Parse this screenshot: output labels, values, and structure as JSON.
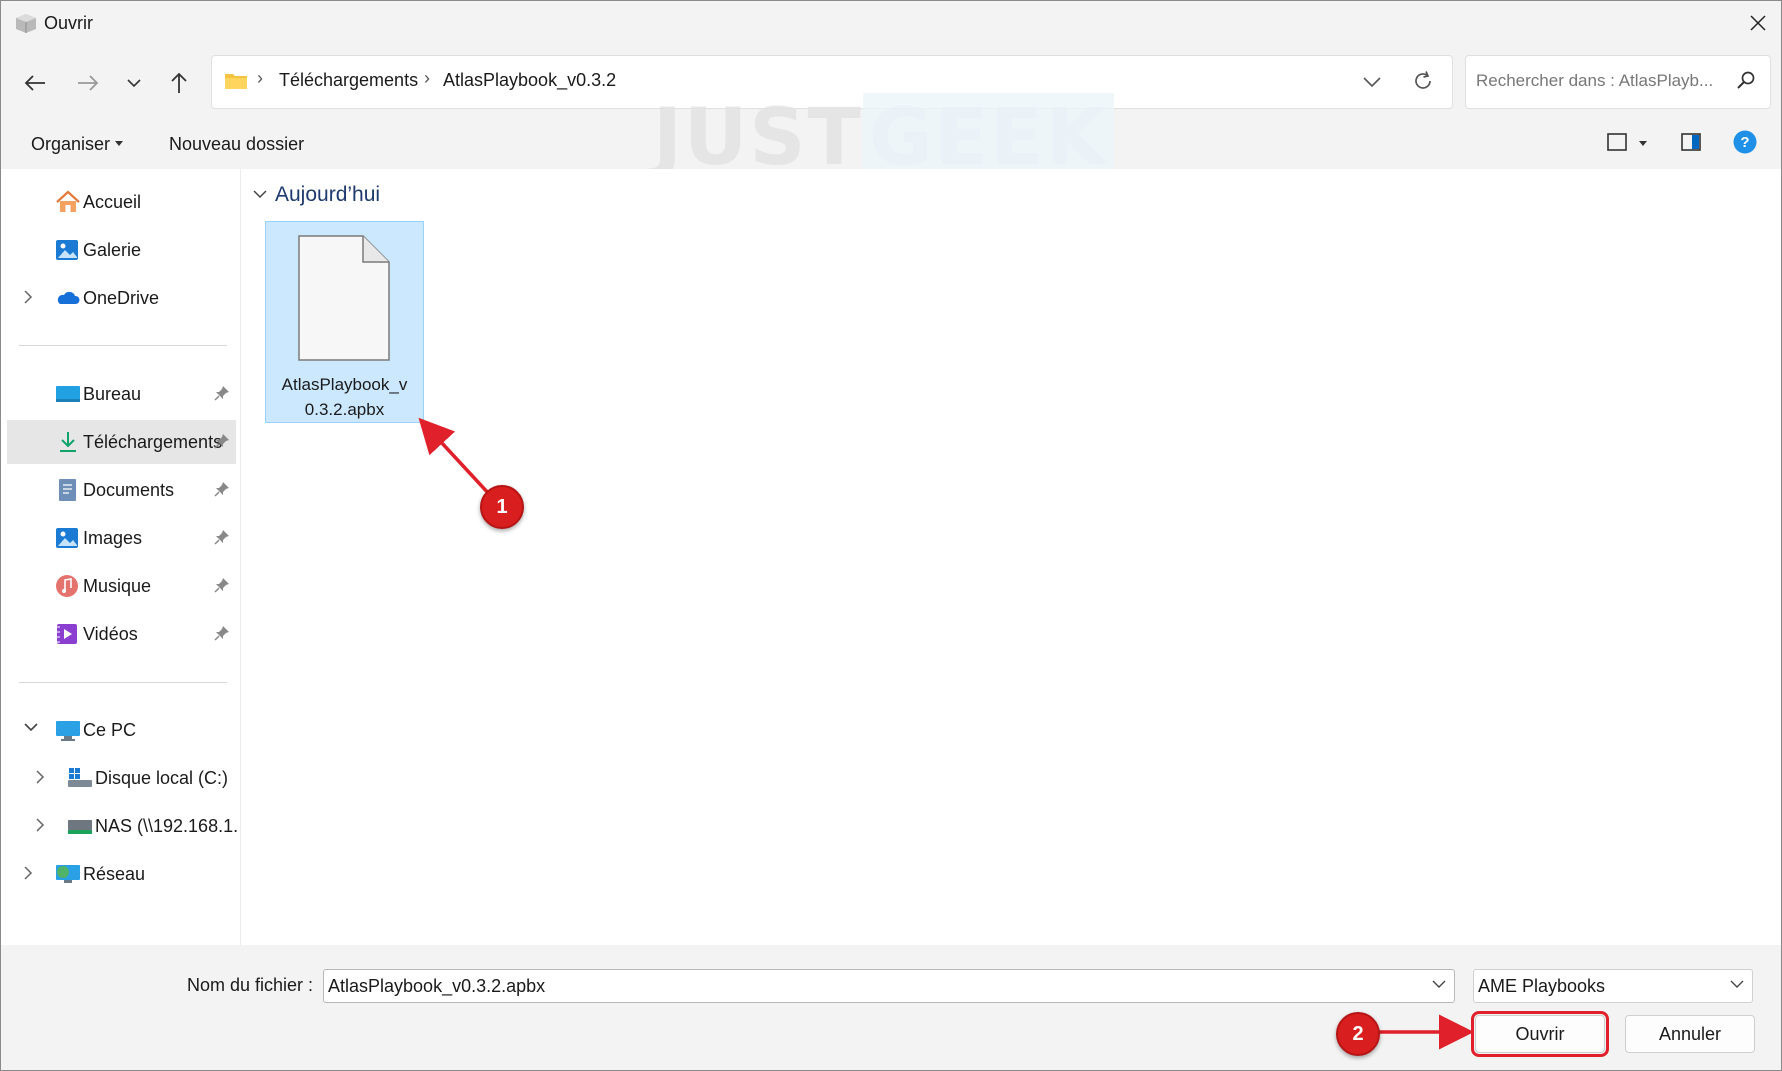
{
  "window": {
    "title": "Ouvrir"
  },
  "address": {
    "crumbs": [
      "Téléchargements",
      "AtlasPlaybook_v0.3.2"
    ],
    "separator": "›"
  },
  "search": {
    "placeholder": "Rechercher dans : AtlasPlayb..."
  },
  "commandbar": {
    "organize": "Organiser",
    "new_folder": "Nouveau dossier"
  },
  "watermark": {
    "part1": "JUST",
    "part2": "GEEK"
  },
  "sidebar": {
    "items": [
      {
        "label": "Accueil",
        "icon": "home-icon"
      },
      {
        "label": "Galerie",
        "icon": "gallery-icon"
      },
      {
        "label": "OneDrive",
        "icon": "onedrive-icon"
      },
      {
        "label": "Bureau",
        "icon": "desktop-icon"
      },
      {
        "label": "Téléchargements",
        "icon": "download-icon"
      },
      {
        "label": "Documents",
        "icon": "documents-icon"
      },
      {
        "label": "Images",
        "icon": "images-icon"
      },
      {
        "label": "Musique",
        "icon": "music-icon"
      },
      {
        "label": "Vidéos",
        "icon": "videos-icon"
      },
      {
        "label": "Ce PC",
        "icon": "pc-icon"
      },
      {
        "label": "Disque local (C:)",
        "icon": "drive-icon"
      },
      {
        "label": "NAS (\\\\192.168.1.",
        "icon": "nas-icon"
      },
      {
        "label": "Réseau",
        "icon": "network-icon"
      }
    ]
  },
  "main": {
    "group_label": "Aujourd’hui",
    "files": [
      {
        "name_line1": "AtlasPlaybook_v",
        "name_line2": "0.3.2.apbx"
      }
    ]
  },
  "footer": {
    "filename_label": "Nom du fichier :",
    "filename_value": "AtlasPlaybook_v0.3.2.apbx",
    "filetype_value": "AME Playbooks",
    "open_label": "Ouvrir",
    "cancel_label": "Annuler"
  },
  "annotations": {
    "step1": "1",
    "step2": "2"
  },
  "colors": {
    "accent": "#0067c0",
    "selection": "#cce8ff",
    "annotation": "#d81e1e",
    "folder": "#f5c342"
  }
}
